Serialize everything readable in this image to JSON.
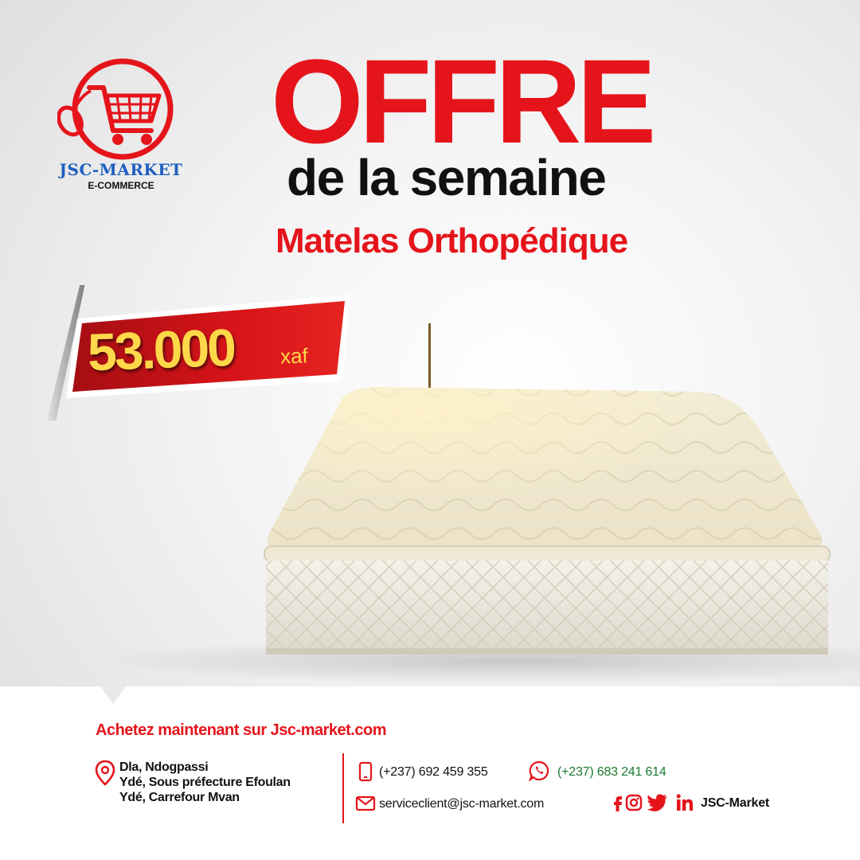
{
  "brand": {
    "name": "JSC-MARKET",
    "tagline": "E-COMMERCE",
    "logo_icon": "shopping-cart-mouse-icon"
  },
  "headline": {
    "title": "OFFRE",
    "subtitle": "de la semaine",
    "product": "Matelas Orthopédique"
  },
  "price": {
    "amount": "53.000",
    "currency": "xaf"
  },
  "footer": {
    "cta_prefix": "Achetez maintenant sur ",
    "cta_site": "Jsc-market.com",
    "address_lines": [
      "Dla, Ndogpassi",
      "Ydé, Sous préfecture Efoulan",
      "Ydé, Carrefour Mvan"
    ],
    "phone": "(+237) 692 459 355",
    "whatsapp": "(+237) 683 241 614",
    "email": "serviceclient@jsc-market.com",
    "social_handle": "JSC-Market",
    "social_icons": [
      "facebook-icon",
      "instagram-icon",
      "twitter-icon",
      "linkedin-icon"
    ]
  },
  "colors": {
    "accent_red": "#e5141b",
    "price_yellow": "#ffd84a",
    "brand_blue": "#1f5fc0",
    "whatsapp_green": "#1a7a2e"
  }
}
